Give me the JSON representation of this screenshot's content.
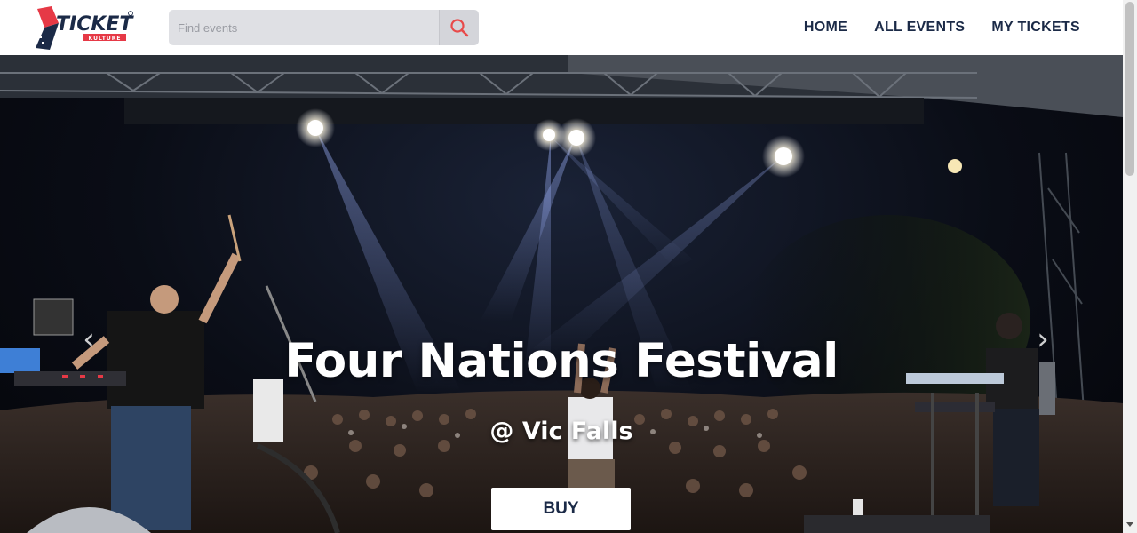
{
  "brand": {
    "logo_text": "TICKET",
    "logo_subtext": "KULTURE",
    "colors": {
      "red": "#e63946",
      "navy": "#1b2a47"
    }
  },
  "search": {
    "placeholder": "Find events",
    "value": "",
    "icon": "search-icon",
    "icon_color": "#e84a4a"
  },
  "nav": {
    "items": [
      {
        "label": "HOME"
      },
      {
        "label": "ALL EVENTS"
      },
      {
        "label": "MY TICKETS"
      }
    ]
  },
  "hero": {
    "title": "Four Nations Festival",
    "subtitle": "@ Vic Falls",
    "buy_label": "BUY",
    "prev_icon": "chevron-left-icon",
    "next_icon": "chevron-right-icon",
    "prev_glyph": "‹",
    "next_glyph": "›"
  }
}
